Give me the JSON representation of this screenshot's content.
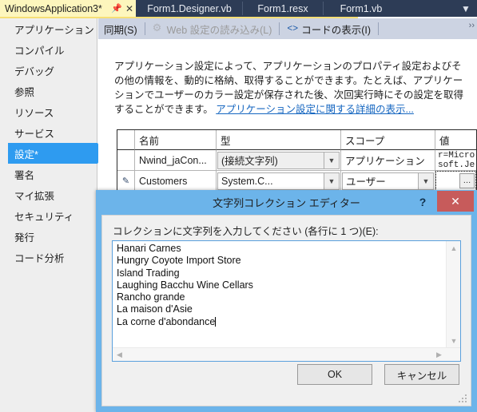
{
  "tabs": {
    "active": {
      "label": "WindowsApplication3*",
      "pin_icon": "pin-icon",
      "close_icon": "close-icon"
    },
    "items": [
      {
        "label": "Form1.Designer.vb"
      },
      {
        "label": "Form1.resx"
      },
      {
        "label": "Form1.vb"
      }
    ],
    "overflow_icon": "chevron-down-icon"
  },
  "sidebar": {
    "items": [
      {
        "label": "アプリケーション",
        "selected": false
      },
      {
        "label": "コンパイル",
        "selected": false
      },
      {
        "label": "デバッグ",
        "selected": false
      },
      {
        "label": "参照",
        "selected": false
      },
      {
        "label": "リソース",
        "selected": false
      },
      {
        "label": "サービス",
        "selected": false
      },
      {
        "label": "設定*",
        "selected": true
      },
      {
        "label": "署名",
        "selected": false
      },
      {
        "label": "マイ拡張",
        "selected": false
      },
      {
        "label": "セキュリティ",
        "selected": false
      },
      {
        "label": "発行",
        "selected": false
      },
      {
        "label": "コード分析",
        "selected": false
      }
    ]
  },
  "toolbar": {
    "sync_label": "同期(S)",
    "web_load_label": "Web 設定の読み込み(L)",
    "web_load_icon": "gear-icon",
    "view_code_label": "コードの表示(I)",
    "view_code_icon": "code-brackets-icon",
    "overflow_icon": "toolbar-overflow-icon"
  },
  "main": {
    "description": "アプリケーション設定によって、アプリケーションのプロパティ設定およびその他の情報を、動的に格納、取得することができます。たとえば、アプリケーションでユーザーのカラー設定が保存された後、次回実行時にその設定を取得することができます。 ",
    "description_link": "アプリケーション設定に関する詳細の表示..."
  },
  "grid": {
    "columns": [
      "",
      "名前",
      "型",
      "スコープ",
      "値"
    ],
    "rows": [
      {
        "marker": "",
        "name": "Nwind_jaCon...",
        "type": "(接続文字列)",
        "type_has_arrow": true,
        "scope": "アプリケーション",
        "scope_has_arrow": false,
        "value": "Provider=Microsoft.Jet.OLE",
        "value_has_ellipsis": false
      },
      {
        "marker": "pencil-icon",
        "name": "Customers",
        "type": "System.C...",
        "type_has_arrow": true,
        "scope": "ユーザー",
        "scope_has_arrow": true,
        "value": "",
        "value_has_ellipsis": true
      }
    ]
  },
  "dialog": {
    "title": "文字列コレクション エディター",
    "help_label": "?",
    "help_icon": "help-icon",
    "close_label": "✕",
    "close_icon": "close-icon",
    "instruction": "コレクションに文字列を入力してください (各行に 1 つ)(E):",
    "editor_lines": [
      "Hanari Carnes",
      "Hungry Coyote Import Store",
      "Island Trading",
      "Laughing Bacchu Wine Cellars",
      "Rancho grande",
      "La maison d'Asie",
      "La corne d'abondance"
    ],
    "scroll": {
      "up_icon": "chevron-up-icon",
      "down_icon": "chevron-down-icon",
      "left_icon": "chevron-left-icon",
      "right_icon": "chevron-right-icon"
    },
    "ok_label": "OK",
    "cancel_label": "キャンセル",
    "resize_grip_icon": "resize-grip-icon"
  },
  "colors": {
    "tabstrip_bg": "#2d3c56",
    "active_tab_bg": "#fdf6bd",
    "sidebar_selected": "#2e9bf0",
    "dialog_frame": "#6cb4ea",
    "close_button": "#c75b5b",
    "link": "#1566c0",
    "toolbar_bg": "#ccd3e2"
  }
}
